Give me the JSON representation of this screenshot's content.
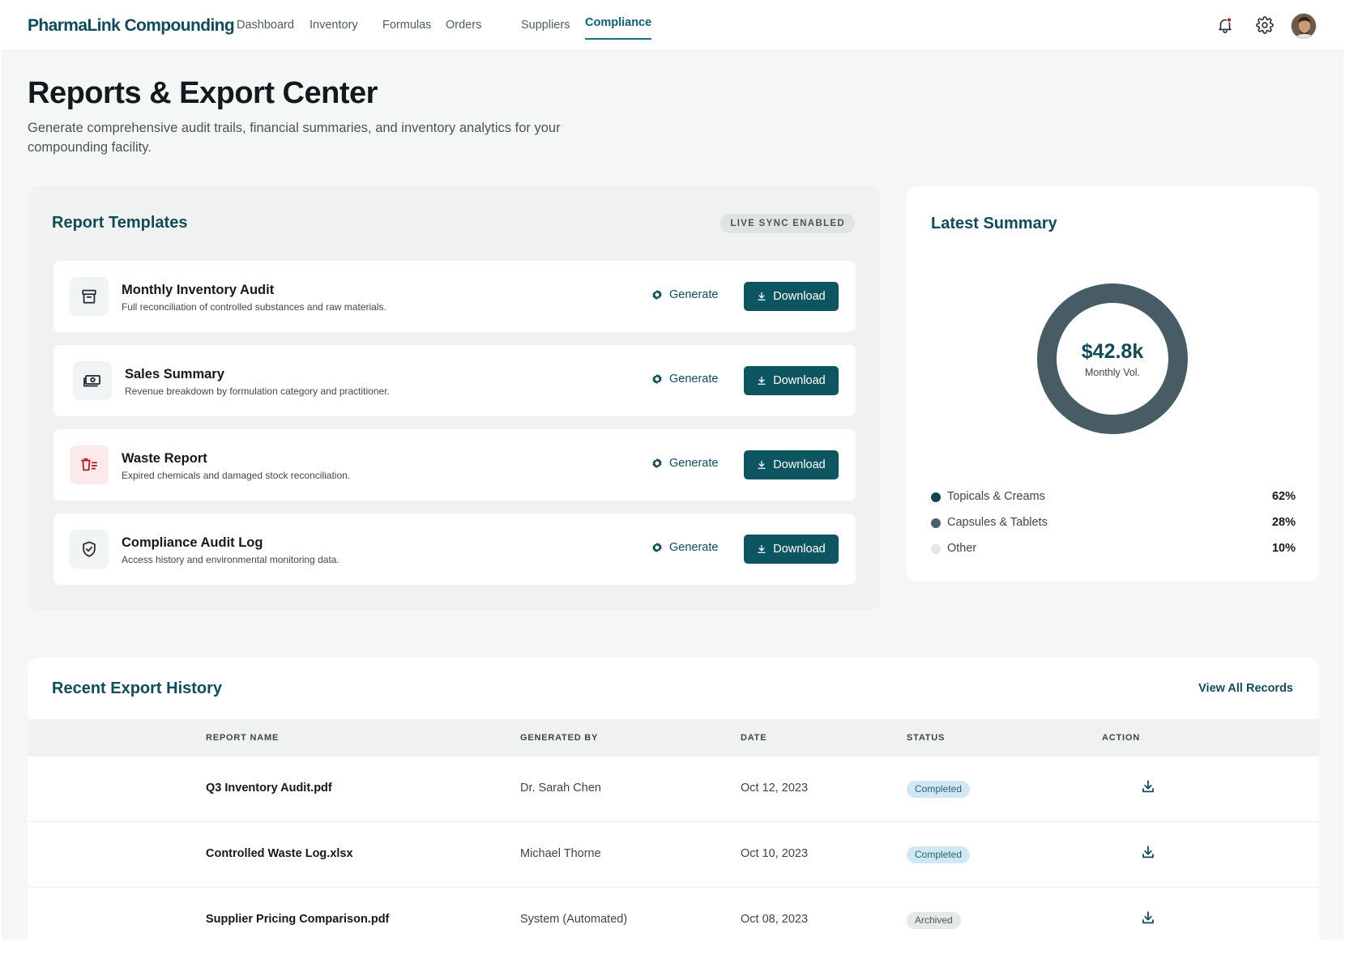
{
  "brand": "PharmaLink Compounding",
  "nav": {
    "items": [
      "Dashboard",
      "Inventory",
      "Formulas",
      "Orders",
      "Suppliers",
      "Compliance"
    ],
    "active": "Compliance"
  },
  "header": {
    "title": "Reports & Export Center",
    "subtitle": "Generate comprehensive audit trails, financial summaries, and inventory analytics for your compounding facility."
  },
  "templates": {
    "title": "Report Templates",
    "badge": "LIVE SYNC ENABLED",
    "generate_label": "Generate",
    "download_label": "Download",
    "items": [
      {
        "name": "Monthly Inventory Audit",
        "description": "Full reconciliation of controlled substances and raw materials.",
        "icon": "archive-box-icon"
      },
      {
        "name": "Sales Summary",
        "description": "Revenue breakdown by formulation category and practitioner.",
        "icon": "cash-icon"
      },
      {
        "name": "Waste Report",
        "description": "Expired chemicals and damaged stock reconciliation.",
        "icon": "waste-bin-icon"
      },
      {
        "name": "Compliance Audit Log",
        "description": "Access history and environmental monitoring data.",
        "icon": "shield-check-icon"
      }
    ]
  },
  "summary": {
    "title": "Latest Summary",
    "value": "$42.8k",
    "value_label": "Monthly Vol.",
    "segments": [
      {
        "name": "Topicals & Creams",
        "percent": "62%",
        "share": 62,
        "color": "#0d4750"
      },
      {
        "name": "Capsules & Tablets",
        "percent": "28%",
        "share": 28,
        "color": "#4a5f69"
      },
      {
        "name": "Other",
        "percent": "10%",
        "share": 10,
        "color": "#e3e6e6"
      }
    ]
  },
  "history": {
    "title": "Recent Export History",
    "view_all": "View All Records",
    "columns": [
      "REPORT NAME",
      "GENERATED BY",
      "DATE",
      "STATUS",
      "ACTION"
    ],
    "rows": [
      {
        "name": "Q3 Inventory Audit.pdf",
        "by": "Dr. Sarah Chen",
        "date": "Oct 12, 2023",
        "status": "Completed"
      },
      {
        "name": "Controlled Waste Log.xlsx",
        "by": "Michael Thorne",
        "date": "Oct 10, 2023",
        "status": "Completed"
      },
      {
        "name": "Supplier Pricing Comparison.pdf",
        "by": "System (Automated)",
        "date": "Oct 08, 2023",
        "status": "Archived"
      }
    ]
  },
  "colors": {
    "brand": "#124b57",
    "primary_button": "#0d5560",
    "notification_dot": "#d4202c"
  }
}
